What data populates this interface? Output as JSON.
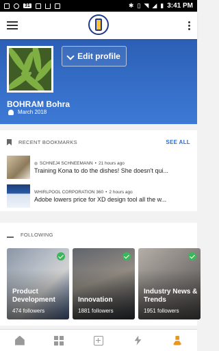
{
  "status_bar": {
    "left_icons": [
      "notification-icon",
      "sync-icon",
      "calendar-icon",
      "mail-icon",
      "download-icon",
      "photo-icon"
    ],
    "calendar_badge": "31",
    "time": "3:41 PM",
    "right_icons": [
      "bluetooth-icon",
      "vibrate-icon",
      "wifi-icon",
      "signal-icon",
      "battery-icon"
    ]
  },
  "header": {
    "menu_icon": "hamburger-icon",
    "logo_icon": "app-logo",
    "more_icon": "overflow-menu-icon"
  },
  "profile": {
    "edit_label": "Edit profile",
    "name": "BOHRAM Bohra",
    "joined": "March 2018",
    "accent": "#3a72d0"
  },
  "bookmarks": {
    "heading": "RECENT BOOKMARKS",
    "see_all": "SEE ALL",
    "items": [
      {
        "source": "SCHNEJ4 SCHNEEMANN",
        "time": "21 hours ago",
        "title": "Training Kona to do the dishes! She doesn't qui..."
      },
      {
        "source": "WHIRLPOOL CORPORATION 360",
        "time": "2 hours ago",
        "title": "Adobe lowers price for XD design tool all the w..."
      }
    ]
  },
  "following": {
    "heading": "FOLLOWING",
    "tiles": [
      {
        "name_line1": "Product",
        "name_line2": "Development",
        "followers": "474 followers"
      },
      {
        "name_line1": "Innovation",
        "name_line2": "",
        "followers": "1881 followers"
      },
      {
        "name_line1": "Industry News &",
        "name_line2": "Trends",
        "followers": "1951 followers"
      }
    ],
    "check_color": "#3cb65a"
  },
  "bottom_nav": {
    "items": [
      "home-icon",
      "grid-icon",
      "add-icon",
      "lightning-icon",
      "profile-icon"
    ],
    "active_color": "#e8961e"
  }
}
